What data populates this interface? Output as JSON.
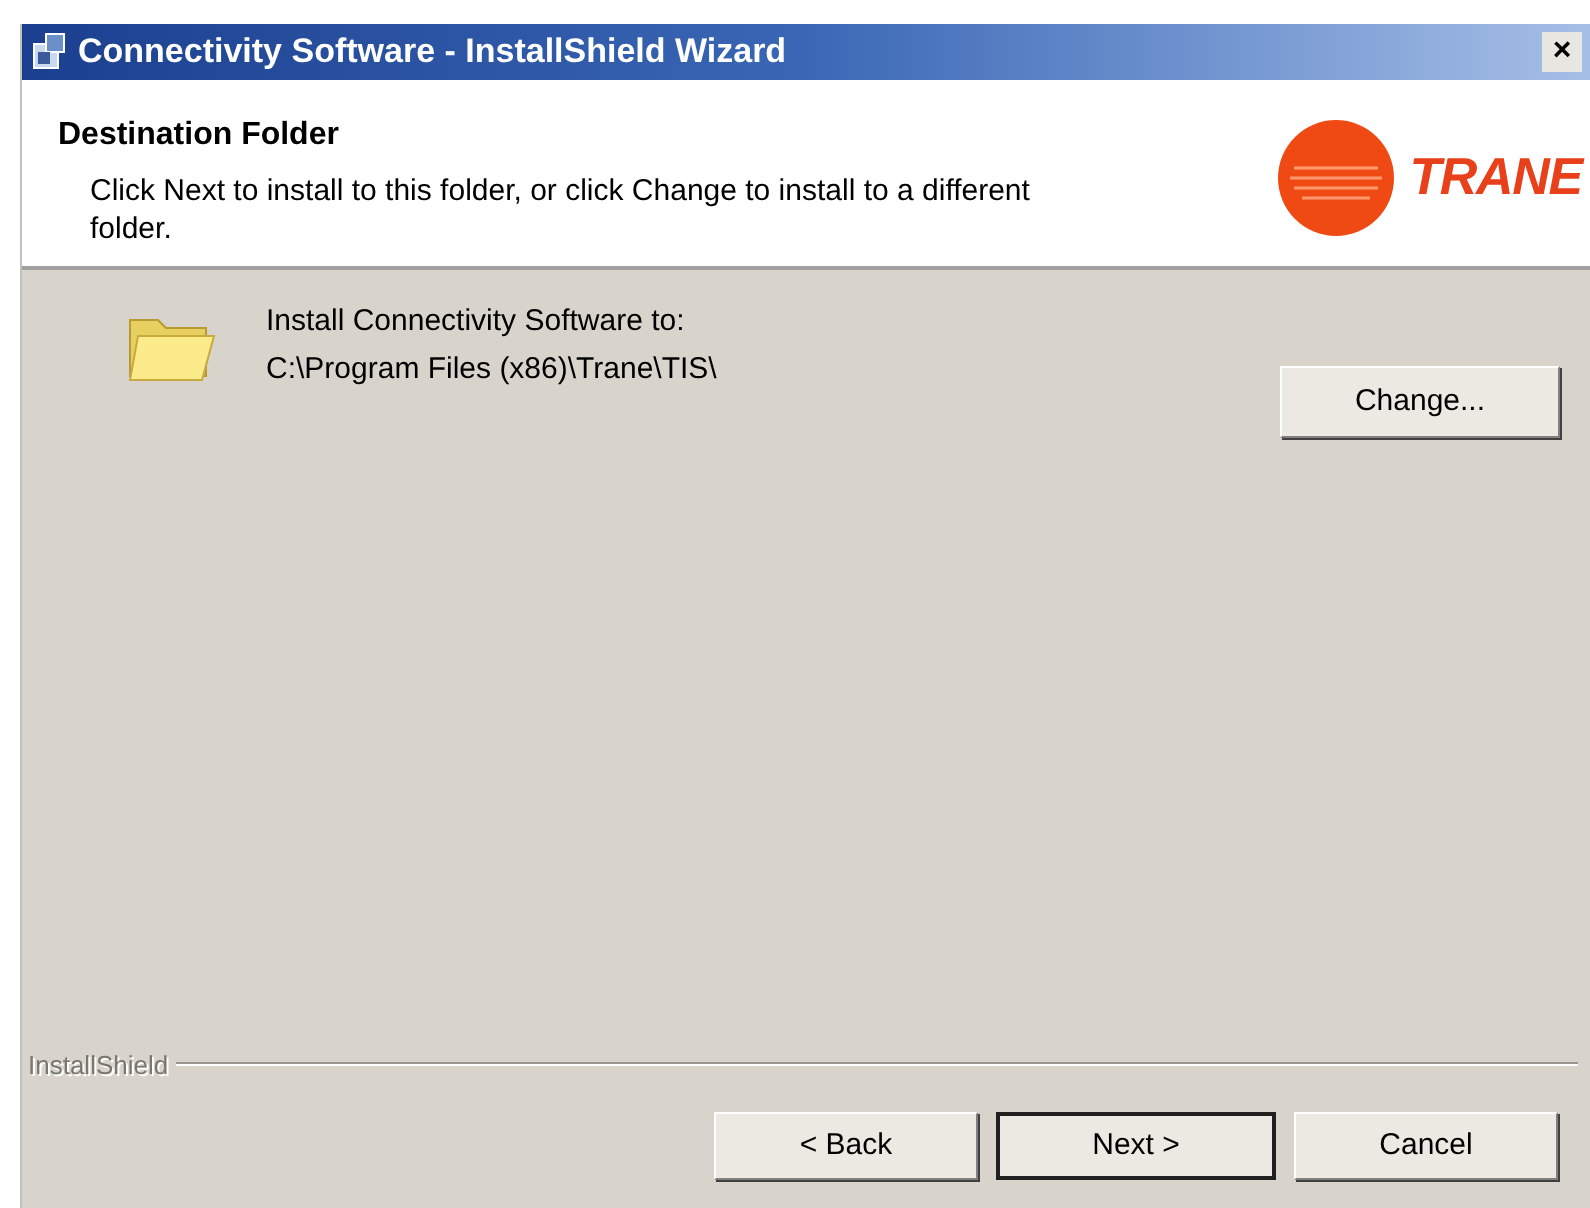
{
  "window": {
    "title": "Connectivity Software - InstallShield Wizard",
    "close": "×"
  },
  "header": {
    "title": "Destination Folder",
    "description": "Click Next to install to this folder, or click Change to install to a different folder.",
    "logo_text": "TRANE"
  },
  "destination": {
    "label": "Install Connectivity Software to:",
    "path": "C:\\Program Files (x86)\\Trane\\TIS\\",
    "change_button": "Change..."
  },
  "footer": {
    "brand": "InstallShield"
  },
  "buttons": [
    {
      "label": "< Back",
      "default": false
    },
    {
      "label": "Next >",
      "default": true
    },
    {
      "label": "Cancel",
      "default": false
    }
  ]
}
